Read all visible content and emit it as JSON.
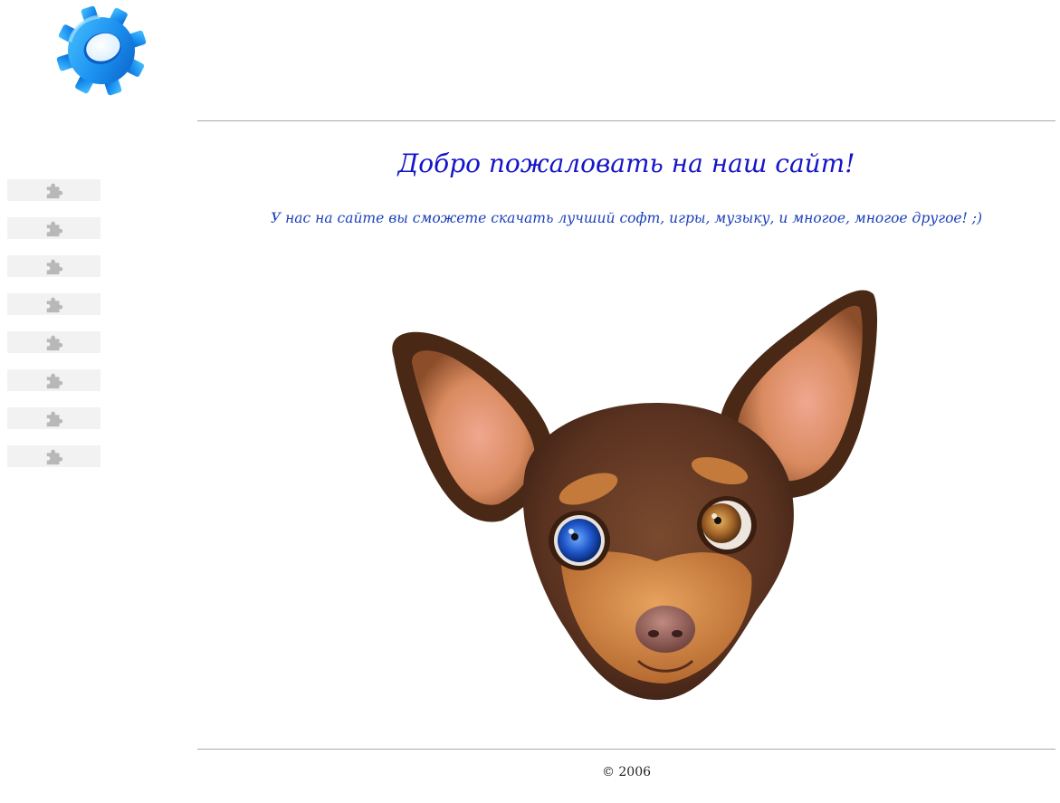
{
  "header": {
    "logo_icon": "gear-icon",
    "logo_color": "#1e90ff"
  },
  "sidebar": {
    "item_icon": "puzzle-piece-icon",
    "item_count": 8,
    "item_background": "#f2f2f2",
    "icon_color": "#b8b8b8"
  },
  "main": {
    "title": "Добро пожаловать на наш сайт!",
    "subtitle": "У нас на сайте вы сможете скачать лучший софт, игры, музыку, и многое, многое другое! ;)",
    "title_color": "#1515c8",
    "subtitle_color": "#1b3fb8",
    "image_icon": "dog-head-image"
  },
  "footer": {
    "copyright": "© 2006"
  }
}
